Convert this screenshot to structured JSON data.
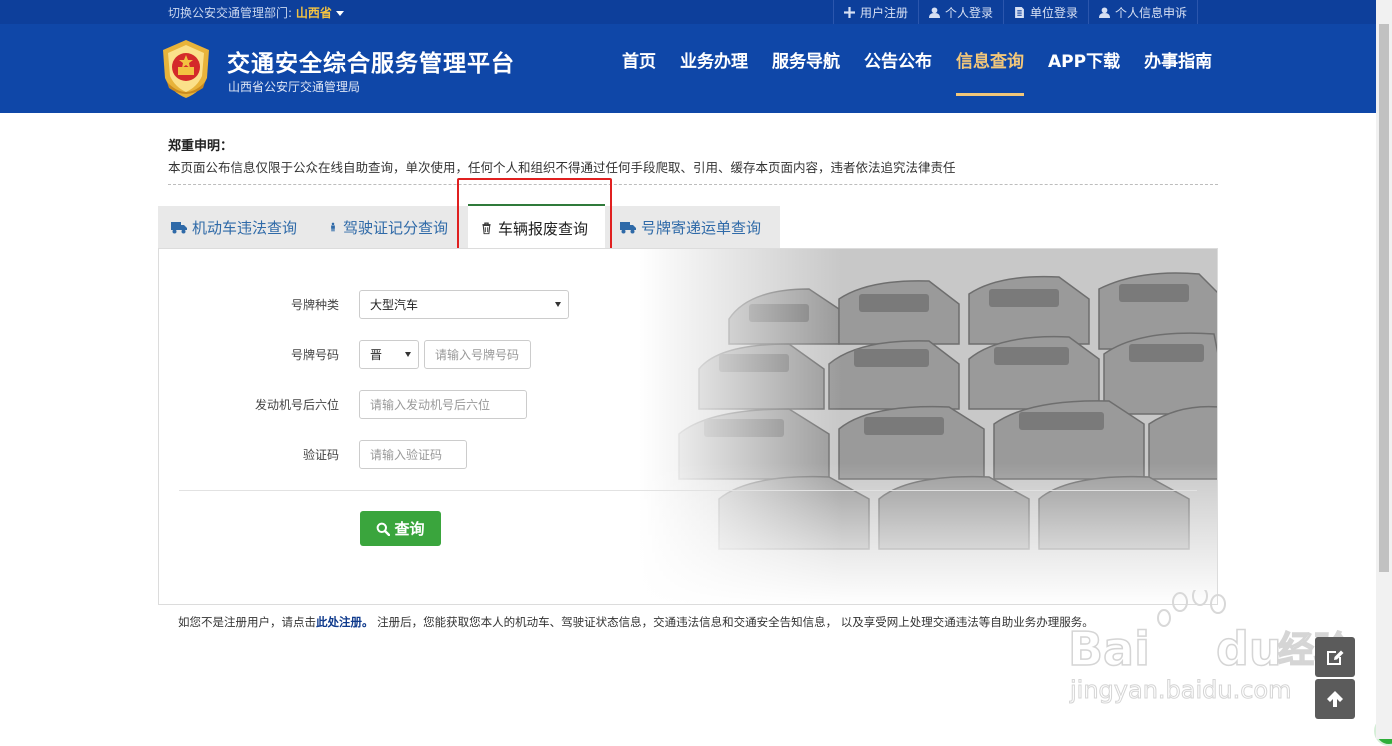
{
  "topbar": {
    "dept_label": "切换公安交通管理部门:",
    "dept_value": "山西省",
    "links": [
      {
        "label": "用户注册",
        "icon": "plus-icon"
      },
      {
        "label": "个人登录",
        "icon": "user-icon"
      },
      {
        "label": "单位登录",
        "icon": "document-icon"
      },
      {
        "label": "个人信息申诉",
        "icon": "user-icon"
      }
    ]
  },
  "header": {
    "title": "交通安全综合服务管理平台",
    "subtitle": "山西省公安厅交通管理局",
    "nav": [
      {
        "label": "首页"
      },
      {
        "label": "业务办理"
      },
      {
        "label": "服务导航"
      },
      {
        "label": "公告公布"
      },
      {
        "label": "信息查询",
        "active": true
      },
      {
        "label": "APP下载"
      },
      {
        "label": "办事指南"
      }
    ]
  },
  "notice": {
    "title": "郑重申明：",
    "text": "本页面公布信息仅限于公众在线自助查询，单次使用，任何个人和组织不得通过任何手段爬取、引用、缓存本页面内容，违者依法追究法律责任"
  },
  "tabs": [
    {
      "label": "机动车违法查询",
      "icon": "truck-icon"
    },
    {
      "label": "驾驶证记分查询",
      "icon": "person-icon"
    },
    {
      "label": "车辆报废查询",
      "icon": "trash-icon",
      "active": true
    },
    {
      "label": "号牌寄递运单查询",
      "icon": "truck-icon"
    }
  ],
  "form": {
    "plate_type_label": "号牌种类",
    "plate_type_value": "大型汽车",
    "plate_no_label": "号牌号码",
    "plate_prefix": "晋",
    "plate_no_placeholder": "请输入号牌号码",
    "engine_label": "发动机号后六位",
    "engine_placeholder": "请输入发动机号后六位",
    "captcha_label": "验证码",
    "captcha_placeholder": "请输入验证码",
    "submit_label": "查询"
  },
  "footer": {
    "prefix": "如您不是注册用户，请点击",
    "link": "此处注册。",
    "suffix": " 注册后，您能获取您本人的机动车、驾驶证状态信息，交通违法信息和交通安全告知信息， 以及享受网上处理交通违法等自助业务办理服务。"
  },
  "watermark": {
    "brand": "Bai",
    "brand2": "du",
    "cn": "经验",
    "url": "jingyan.baidu.com"
  },
  "colors": {
    "header_bg": "#0f47a8",
    "topbar_bg": "#0d3f9b",
    "active_nav": "#f2c77a",
    "tab_text": "#2f6aa8",
    "button_green": "#3aa53d",
    "highlight_red": "#e02020"
  }
}
